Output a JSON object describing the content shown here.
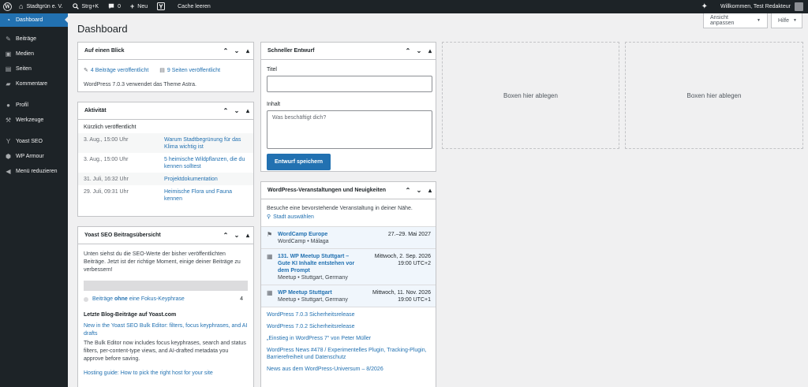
{
  "adminbar": {
    "site_name": "Stadtgrün e. V.",
    "search_shortcut": "Strg+K",
    "comments_count": "0",
    "new_label": "Neu",
    "cache_label": "Cache leeren",
    "welcome": "Willkommen, Test Redakteur"
  },
  "sidebar": {
    "items": [
      {
        "label": "Dashboard",
        "icon": "dashboard-icon"
      },
      {
        "label": "Beiträge",
        "icon": "pin-icon"
      },
      {
        "label": "Medien",
        "icon": "media-icon"
      },
      {
        "label": "Seiten",
        "icon": "pages-icon"
      },
      {
        "label": "Kommentare",
        "icon": "comments-icon"
      },
      {
        "label": "Profil",
        "icon": "user-icon"
      },
      {
        "label": "Werkzeuge",
        "icon": "wrench-icon"
      },
      {
        "label": "Yoast SEO",
        "icon": "yoast-icon"
      },
      {
        "label": "WP Armour",
        "icon": "shield-icon"
      },
      {
        "label": "Menü reduzieren",
        "icon": "collapse-icon"
      }
    ]
  },
  "header": {
    "title": "Dashboard",
    "screen_options": "Ansicht anpassen",
    "help": "Hilfe"
  },
  "glance": {
    "title": "Auf einen Blick",
    "posts": "4 Beiträge veröffentlicht",
    "pages": "9 Seiten veröffentlicht",
    "info": "WordPress 7.0.3 verwendet das Theme Astra."
  },
  "activity": {
    "title": "Aktivität",
    "recent_label": "Kürzlich veröffentlicht",
    "rows": [
      {
        "date": "3. Aug., 15:00 Uhr",
        "title": "Warum Stadtbegrünung für das Klima wichtig ist"
      },
      {
        "date": "3. Aug., 15:00 Uhr",
        "title": "5 heimische Wildpflanzen, die du kennen solltest"
      },
      {
        "date": "31. Juli, 16:32 Uhr",
        "title": "Projektdokumentation"
      },
      {
        "date": "29. Juli, 09:31 Uhr",
        "title": "Heimische Flora und Fauna kennen"
      }
    ]
  },
  "yoast": {
    "title": "Yoast SEO Beitragsübersicht",
    "intro": "Unten siehst du die SEO-Werte der bisher veröffentlichten Beiträge. Jetzt ist der richtige Moment, einige deiner Beiträge zu verbessern!",
    "row_pre": "Beiträge ",
    "row_bold": "ohne",
    "row_post": " eine Fokus-Keyphrase",
    "row_count": "4",
    "blog_title": "Letzte Blog-Beiträge auf Yoast.com",
    "post1_link": "New in the Yoast SEO Bulk Editor: filters, focus keyphrases, and AI drafts",
    "post1_desc": "The Bulk Editor now includes focus keyphrases, search and status filters, per-content-type views, and AI-drafted metadata you approve before saving.",
    "post2_link": "Hosting guide: How to pick the right host for your site"
  },
  "quickdraft": {
    "title": "Schneller Entwurf",
    "title_label": "Titel",
    "content_label": "Inhalt",
    "content_placeholder": "Was beschäftigt dich?",
    "save": "Entwurf speichern"
  },
  "events": {
    "title": "WordPress-Veranstaltungen und Neuigkeiten",
    "intro": "Besuche eine bevorstehende Veranstaltung in deiner Nähe.",
    "select_city": "Stadt auswählen",
    "items": [
      {
        "title": "WordCamp Europe",
        "meta": "WordCamp • Málaga",
        "date": "27.–29. Mai 2027",
        "time": ""
      },
      {
        "title": "131. WP Meetup Stuttgart – Gute KI Inhalte entstehen vor dem Prompt",
        "meta": "Meetup • Stuttgart, Germany",
        "date": "Mittwoch, 2. Sep. 2026",
        "time": "19:00 UTC+2"
      },
      {
        "title": "WP Meetup Stuttgart",
        "meta": "Meetup • Stuttgart, Germany",
        "date": "Mittwoch, 11. Nov. 2026",
        "time": "19:00 UTC+1"
      }
    ],
    "news": [
      "WordPress 7.0.3 Sicherheitsrelease",
      "WordPress 7.0.2 Sicherheitsrelease",
      "„Einstieg in WordPress 7“ von Peter Müller",
      "WordPress News #478 / Experimentelles Plugin, Tracking-Plugin, Barrierefreiheit und Datenschutz",
      "News aus dem WordPress-Universum – 8/2026"
    ]
  },
  "dropzone": {
    "label": "Boxen hier ablegen"
  },
  "colors": {
    "adminbar": "#1d2327",
    "accent": "#2271b1",
    "background": "#f0f0f1"
  }
}
